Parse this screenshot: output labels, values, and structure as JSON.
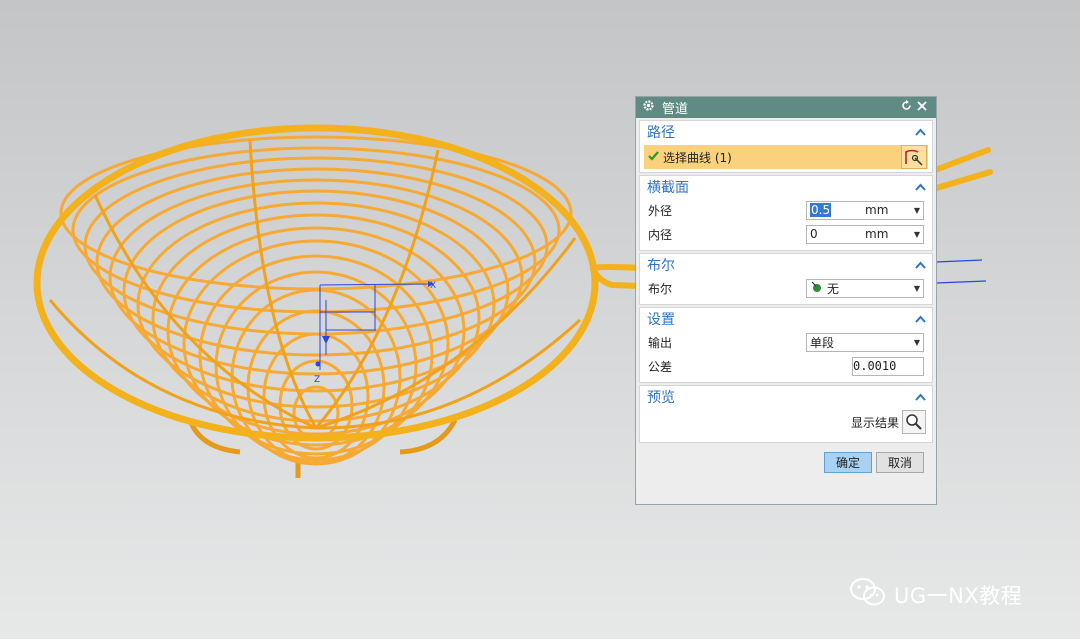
{
  "dialog": {
    "title": "管道",
    "sections": {
      "path": {
        "title": "路径",
        "curve_label": "选择曲线 (1)"
      },
      "cross_section": {
        "title": "横截面",
        "outer": {
          "label": "外径",
          "value": "0.5",
          "unit": "mm"
        },
        "inner": {
          "label": "内径",
          "value": "0",
          "unit": "mm"
        }
      },
      "boolean": {
        "title": "布尔",
        "label": "布尔",
        "value": "无"
      },
      "settings": {
        "title": "设置",
        "output": {
          "label": "输出",
          "value": "单段"
        },
        "tolerance": {
          "label": "公差",
          "value": "0.0010"
        }
      },
      "preview": {
        "title": "预览",
        "show_result_label": "显示结果"
      }
    },
    "buttons": {
      "ok": "确定",
      "cancel": "取消"
    }
  },
  "viewport": {
    "axis_x_label": "X",
    "axis_z_label": "Z",
    "basket_color": "#f6a933",
    "rim_color": "#f3b21c"
  },
  "watermark": {
    "text": "UG一NX教程"
  },
  "colors": {
    "title_bar": "#5f8b83",
    "section_title": "#2f73c7",
    "selected_row": "#fad27d",
    "ok_button": "#a9d2f2"
  }
}
